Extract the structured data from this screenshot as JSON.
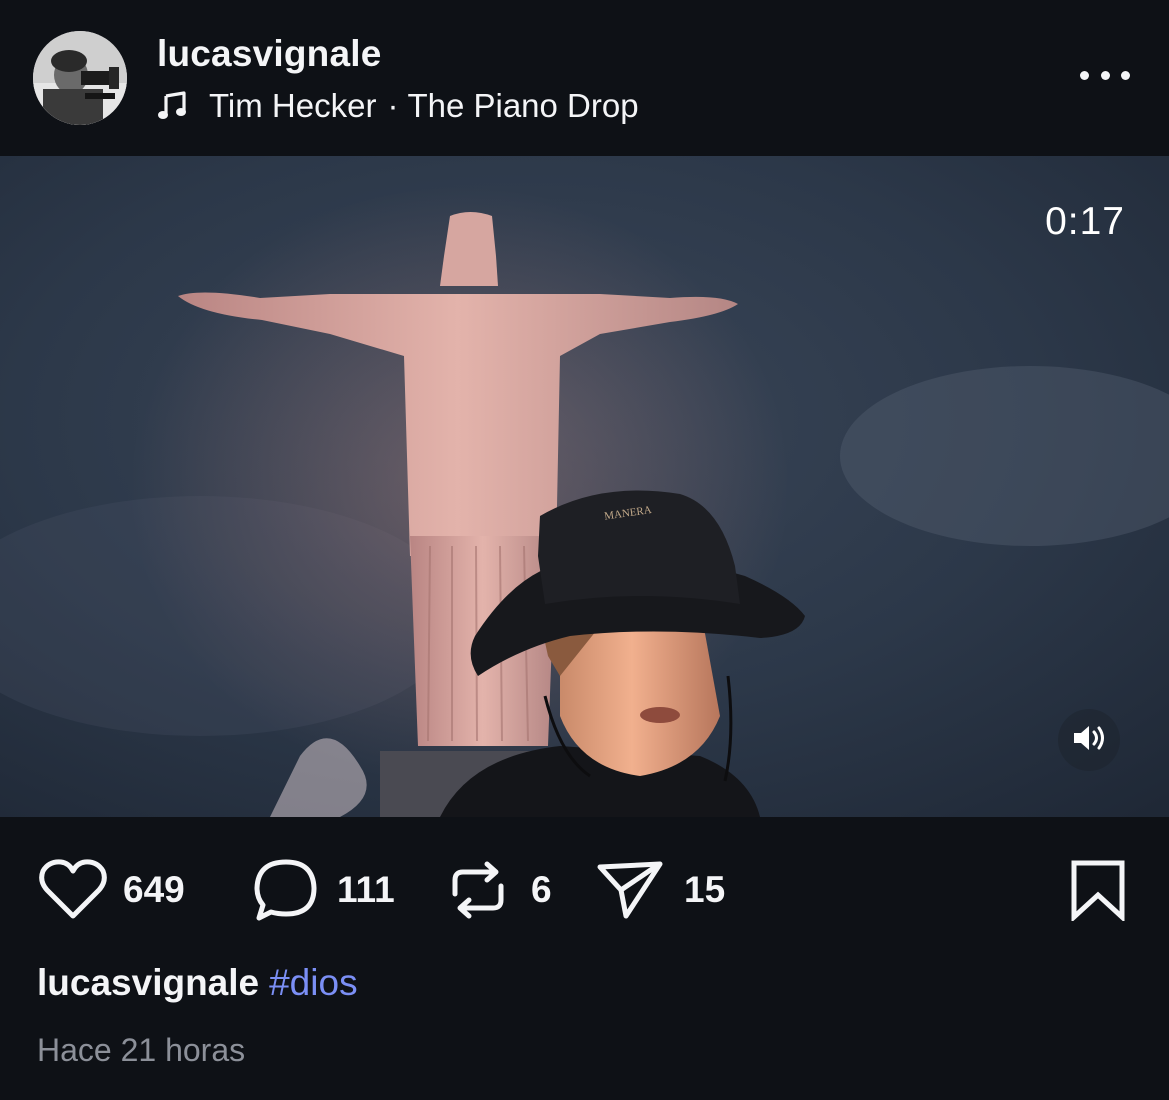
{
  "post": {
    "username": "lucasvignale",
    "music": {
      "icon": "music-note-icon",
      "artist": "Tim Hecker",
      "separator": "·",
      "track": "The Piano Drop"
    },
    "more_icon": "more-horizontal-icon"
  },
  "video": {
    "timer": "0:17",
    "hat_text": "MANERA",
    "volume_icon": "volume-icon"
  },
  "actions": {
    "likes": "649",
    "comments": "111",
    "reposts": "6",
    "shares": "15"
  },
  "caption": {
    "username": "lucasvignale",
    "hashtag": "#dios"
  },
  "timestamp": "Hace 21 horas",
  "colors": {
    "background": "#0e1116",
    "text": "#f4f5f7",
    "hashtag": "#7b8ff5",
    "muted": "#8c9099"
  }
}
